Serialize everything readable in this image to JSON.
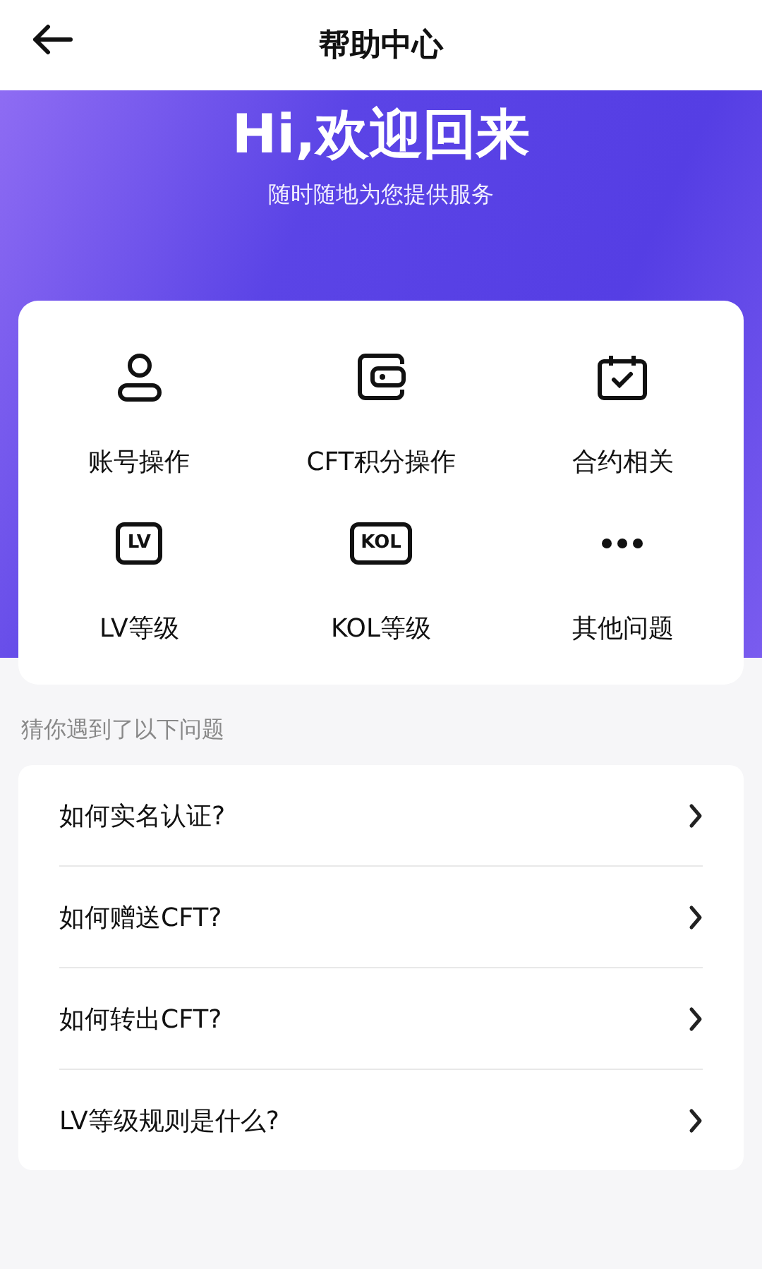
{
  "header": {
    "title": "帮助中心"
  },
  "banner": {
    "title": "Hi,欢迎回来",
    "subtitle": "随时随地为您提供服务"
  },
  "categories": [
    {
      "kind": "person",
      "label": "账号操作"
    },
    {
      "kind": "wallet",
      "label": "CFT积分操作"
    },
    {
      "kind": "calendar",
      "label": "合约相关"
    },
    {
      "kind": "badge",
      "badge": "LV",
      "label": "LV等级"
    },
    {
      "kind": "badge",
      "badge": "KOL",
      "label": "KOL等级"
    },
    {
      "kind": "more",
      "label": "其他问题"
    }
  ],
  "faq": {
    "heading": "猜你遇到了以下问题",
    "items": [
      {
        "question": "如何实名认证?"
      },
      {
        "question": "如何赠送CFT?"
      },
      {
        "question": "如何转出CFT?"
      },
      {
        "question": "LV等级规则是什么?"
      }
    ]
  }
}
